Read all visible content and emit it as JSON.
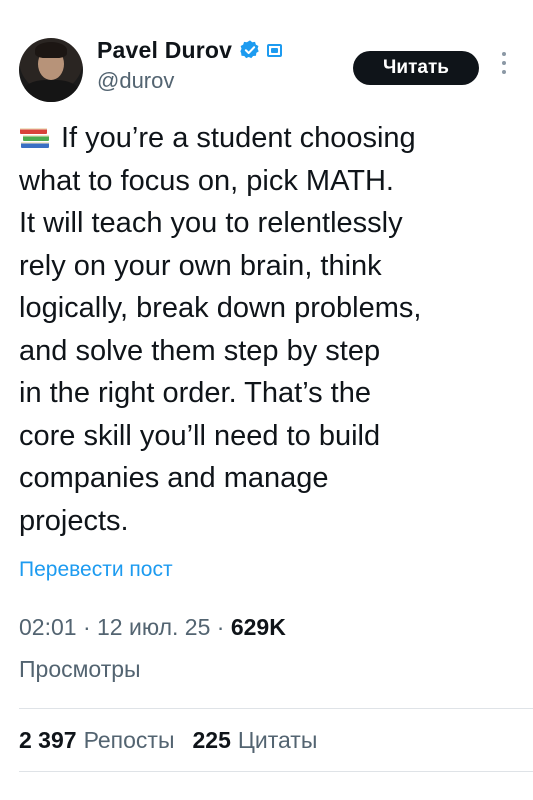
{
  "author": {
    "name": "Pavel Durov",
    "handle": "@durov",
    "verified": true
  },
  "follow_label": "Читать",
  "tweet": {
    "emoji_icon": "books-icon",
    "lines": [
      "If you’re a student choosing",
      "what to focus on, pick MATH.",
      "It will teach you to relentlessly",
      "rely on your own brain, think",
      "logically, break down problems,",
      "and solve them step by step",
      "in the right order. That’s the",
      "core skill you’ll need to build",
      "companies and manage",
      "projects."
    ]
  },
  "translate_label": "Перевести пост",
  "meta": {
    "time": "02:01",
    "sep": "·",
    "date": "12 июл. 25",
    "views_count": "629K",
    "views_label": "Просмотры"
  },
  "stats": {
    "reposts_count": "2 397",
    "reposts_label": "Репосты",
    "quotes_count": "225",
    "quotes_label": "Цитаты"
  },
  "colors": {
    "accent": "#1d9bf0",
    "text": "#0f1419",
    "muted": "#536471"
  }
}
